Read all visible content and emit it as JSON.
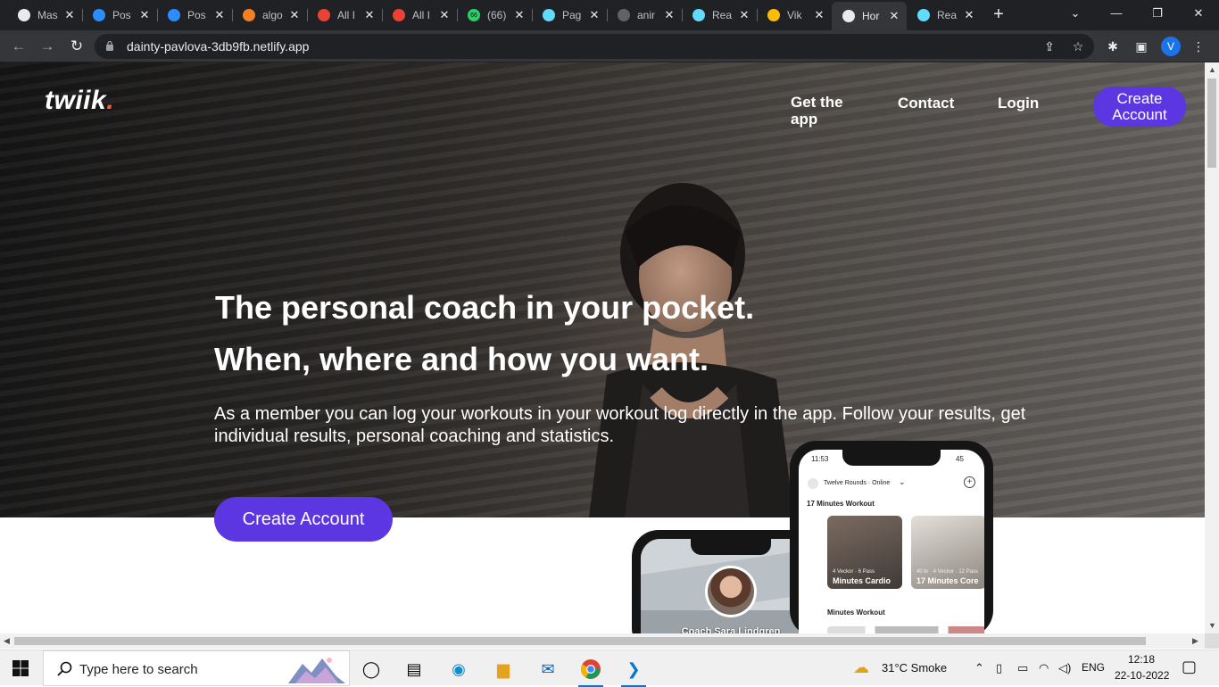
{
  "browser": {
    "tabs": [
      {
        "title": "Mas",
        "icon": "globe-icon",
        "color": "#e8eaed"
      },
      {
        "title": "Pos",
        "icon": "zoom-icon",
        "color": "#2d8cff"
      },
      {
        "title": "Pos",
        "icon": "zoom-icon",
        "color": "#2d8cff"
      },
      {
        "title": "algo",
        "icon": "stackoverflow-icon",
        "color": "#f48024"
      },
      {
        "title": "All I",
        "icon": "gmail-icon",
        "color": "#ea4335"
      },
      {
        "title": "All I",
        "icon": "gmail-icon",
        "color": "#ea4335"
      },
      {
        "title": "(66)",
        "icon": "whatsapp-icon",
        "color": "#25d366",
        "badge": "66"
      },
      {
        "title": "Pag",
        "icon": "react-icon",
        "color": "#61dafb"
      },
      {
        "title": "anir",
        "icon": "github-icon",
        "color": "#5f6368"
      },
      {
        "title": "Rea",
        "icon": "react-icon",
        "color": "#61dafb"
      },
      {
        "title": "Vik",
        "icon": "drive-icon",
        "color": "#fbbc04"
      },
      {
        "title": "Hor",
        "icon": "globe-icon",
        "color": "#e8eaed",
        "active": true
      },
      {
        "title": "Rea",
        "icon": "react-icon",
        "color": "#61dafb"
      }
    ],
    "url": "dainty-pavlova-3db9fb.netlify.app",
    "profile_initial": "V"
  },
  "site": {
    "logo": "twiik",
    "logo_dot": ".",
    "nav": {
      "get_app": "Get the app",
      "contact": "Contact",
      "login": "Login",
      "create_account": "Create Account"
    },
    "hero": {
      "headline_1": "The personal coach in your pocket.",
      "headline_2": "When, where and how you want.",
      "description": "As a member you can log your workouts in your workout log directly in the app. Follow your results, get individual results, personal coaching and statistics.",
      "cta": "Create Account"
    },
    "phone_front": {
      "time": "11:53",
      "battery": "45",
      "group": "Twelve Rounds · Online",
      "section_1": "17 Minutes Workout",
      "card_1_meta": "4 Veckor · 6 Pass",
      "card_1_title": "Minutes Cardio",
      "card_2_meta": "40 kr · 4 Veckor · 12 Pass",
      "card_2_title": "17 Minutes Core",
      "section_2": "Minutes Workout"
    },
    "phone_back": {
      "coach": "Coach Sara Lindgren"
    }
  },
  "taskbar": {
    "search_placeholder": "Type here to search",
    "weather": "31°C  Smoke",
    "lang": "ENG",
    "time": "12:18",
    "date": "22-10-2022"
  }
}
